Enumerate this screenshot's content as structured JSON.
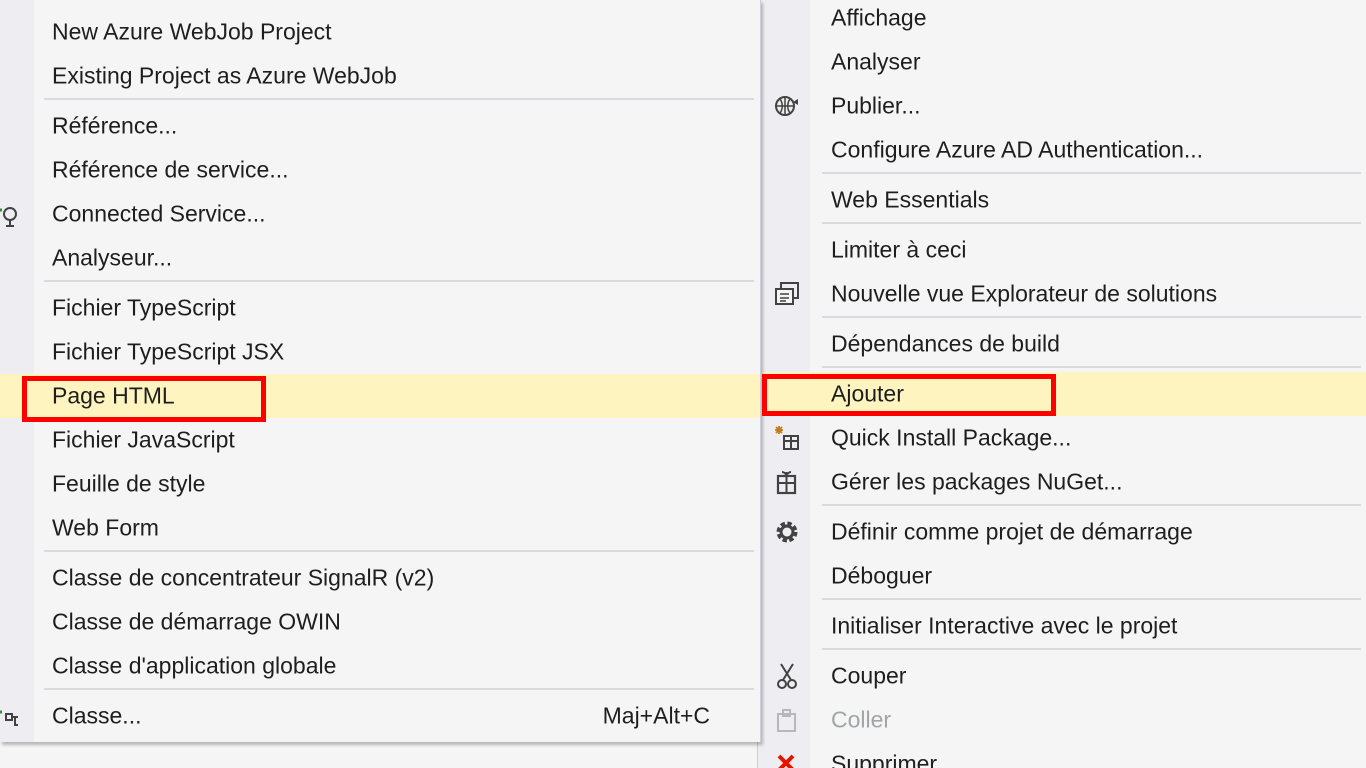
{
  "submenu": {
    "items": [
      {
        "label": "New Azure WebJob Project"
      },
      {
        "label": "Existing Project as Azure WebJob"
      },
      {
        "label": "Référence..."
      },
      {
        "label": "Référence de service..."
      },
      {
        "label": "Connected Service...",
        "icon": "connected-service-icon"
      },
      {
        "label": "Analyseur..."
      },
      {
        "label": "Fichier TypeScript"
      },
      {
        "label": "Fichier TypeScript JSX"
      },
      {
        "label": "Page HTML",
        "state": "highlighted"
      },
      {
        "label": "Fichier JavaScript"
      },
      {
        "label": "Feuille de style"
      },
      {
        "label": "Web Form"
      },
      {
        "label": "Classe de concentrateur SignalR (v2)"
      },
      {
        "label": "Classe de démarrage OWIN"
      },
      {
        "label": "Classe d'application globale"
      },
      {
        "label": "Classe...",
        "shortcut": "Maj+Alt+C",
        "icon": "add-class-icon"
      }
    ]
  },
  "mainmenu": {
    "items": [
      {
        "label": "Affichage"
      },
      {
        "label": "Analyser"
      },
      {
        "label": "Publier...",
        "icon": "publish-globe-icon"
      },
      {
        "label": "Configure Azure AD Authentication..."
      },
      {
        "label": "Web Essentials"
      },
      {
        "label": "Limiter à ceci"
      },
      {
        "label": "Nouvelle vue Explorateur de solutions",
        "icon": "new-solution-view-icon"
      },
      {
        "label": "Dépendances de build"
      },
      {
        "label": "Ajouter",
        "state": "highlighted"
      },
      {
        "label": "Quick Install Package...",
        "icon": "quick-install-package-icon"
      },
      {
        "label": "Gérer les packages NuGet...",
        "icon": "nuget-package-icon"
      },
      {
        "label": "Définir comme projet de démarrage",
        "icon": "gear-icon"
      },
      {
        "label": "Déboguer"
      },
      {
        "label": "Initialiser Interactive avec le projet"
      },
      {
        "label": "Couper",
        "icon": "scissors-icon"
      },
      {
        "label": "Coller",
        "state": "disabled",
        "icon": "clipboard-icon"
      },
      {
        "label": "Supprimer",
        "icon": "delete-x-icon"
      }
    ]
  },
  "annotation": {
    "color": "#ff0000",
    "highlighted_items": [
      "Page HTML",
      "Ajouter"
    ]
  },
  "colors": {
    "menu_background": "#f5f5f5",
    "gutter": "#eeeef2",
    "highlight": "#fdf4bf",
    "separator": "#d9d9de",
    "disabled_text": "#a2a4a5"
  }
}
